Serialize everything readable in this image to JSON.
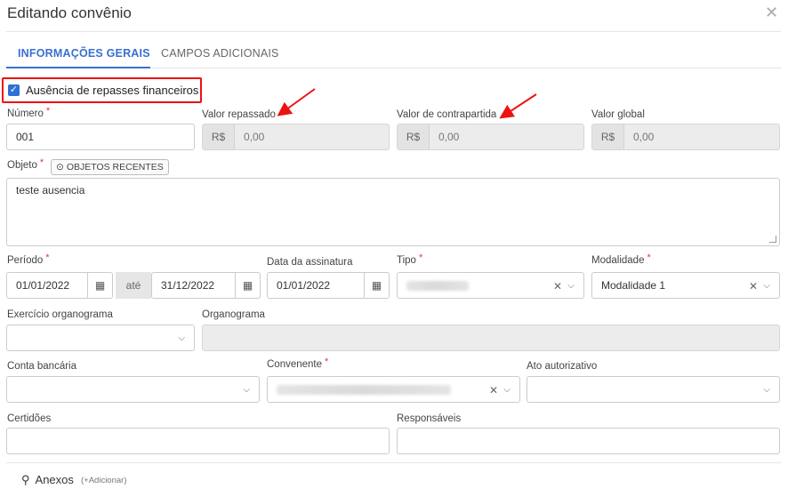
{
  "modal": {
    "title": "Editando convênio",
    "close_icon": "close-icon"
  },
  "tabs": [
    {
      "label": "INFORMAÇÕES GERAIS",
      "active": true
    },
    {
      "label": "CAMPOS ADICIONAIS",
      "active": false
    }
  ],
  "checkbox": {
    "label": "Ausência de repasses financeiros",
    "checked": true
  },
  "fields": {
    "numero": {
      "label": "Número",
      "value": "001",
      "required": true
    },
    "valor_repassado": {
      "label": "Valor repassado",
      "prefix": "R$",
      "value": "0,00"
    },
    "valor_contrapartida": {
      "label": "Valor de contrapartida",
      "prefix": "R$",
      "value": "0,00"
    },
    "valor_global": {
      "label": "Valor global",
      "prefix": "R$",
      "value": "0,00"
    },
    "objeto": {
      "label": "Objeto",
      "required": true,
      "value": "teste ausencia",
      "recent_button": "OBJETOS RECENTES"
    },
    "periodo": {
      "label": "Período",
      "required": true,
      "start": "01/01/2022",
      "separator": "até",
      "end": "31/12/2022"
    },
    "data_assinatura": {
      "label": "Data da assinatura",
      "value": "01/01/2022"
    },
    "tipo": {
      "label": "Tipo",
      "required": true,
      "value": ""
    },
    "modalidade": {
      "label": "Modalidade",
      "required": true,
      "value": "Modalidade 1"
    },
    "exercicio_organograma": {
      "label": "Exercício organograma",
      "value": ""
    },
    "organograma": {
      "label": "Organograma",
      "value": ""
    },
    "conta_bancaria": {
      "label": "Conta bancária",
      "value": ""
    },
    "convenente": {
      "label": "Convenente",
      "required": true,
      "value": ""
    },
    "ato_autorizativo": {
      "label": "Ato autorizativo",
      "value": ""
    },
    "certidoes": {
      "label": "Certidões",
      "value": ""
    },
    "responsaveis": {
      "label": "Responsáveis",
      "value": ""
    }
  },
  "anexos": {
    "label": "Anexos",
    "add_label": "(+Adicionar)"
  },
  "colors": {
    "accent": "#3a6fd0",
    "required": "#e33",
    "highlight": "#e11"
  }
}
